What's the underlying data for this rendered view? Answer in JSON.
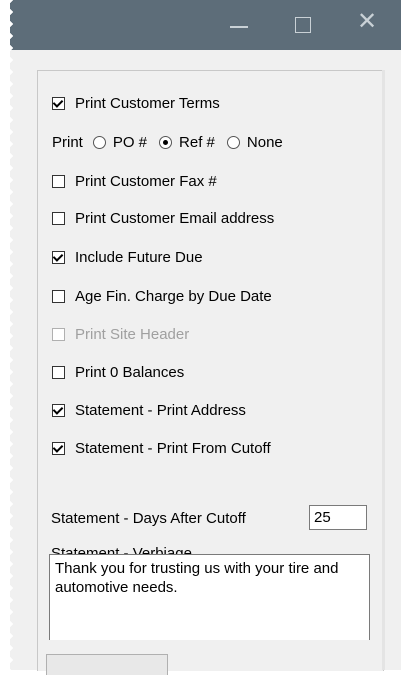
{
  "window": {
    "controls": {
      "minimize": "minimize-icon",
      "maximize": "maximize-icon",
      "close": "close-icon"
    },
    "title_bar_color": "#5d6d79"
  },
  "options": {
    "print_customer_terms": {
      "label": "Print Customer Terms",
      "checked": true
    },
    "print_choice": {
      "label": "Print",
      "options": [
        {
          "label": "PO #",
          "selected": false
        },
        {
          "label": "Ref #",
          "selected": true
        },
        {
          "label": "None",
          "selected": false
        }
      ]
    },
    "print_customer_fax": {
      "label": "Print Customer Fax #",
      "checked": false
    },
    "print_customer_email": {
      "label": "Print Customer Email address",
      "checked": false
    },
    "include_future_due": {
      "label": "Include Future Due",
      "checked": true
    },
    "age_fin_charge": {
      "label": "Age Fin. Charge by Due Date",
      "checked": false
    },
    "print_site_header": {
      "label": "Print Site Header",
      "checked": false,
      "disabled": true
    },
    "print_zero_balances": {
      "label": "Print 0 Balances",
      "checked": false
    },
    "statement_print_address": {
      "label": "Statement - Print Address",
      "checked": true
    },
    "statement_print_from_cutoff": {
      "label": "Statement - Print From Cutoff",
      "checked": true
    }
  },
  "days_after_cutoff": {
    "label": "Statement - Days After Cutoff",
    "value": "25"
  },
  "verbiage": {
    "label": "Statement - Verbiage",
    "value": "Thank you for trusting us with your tire and automotive needs."
  }
}
